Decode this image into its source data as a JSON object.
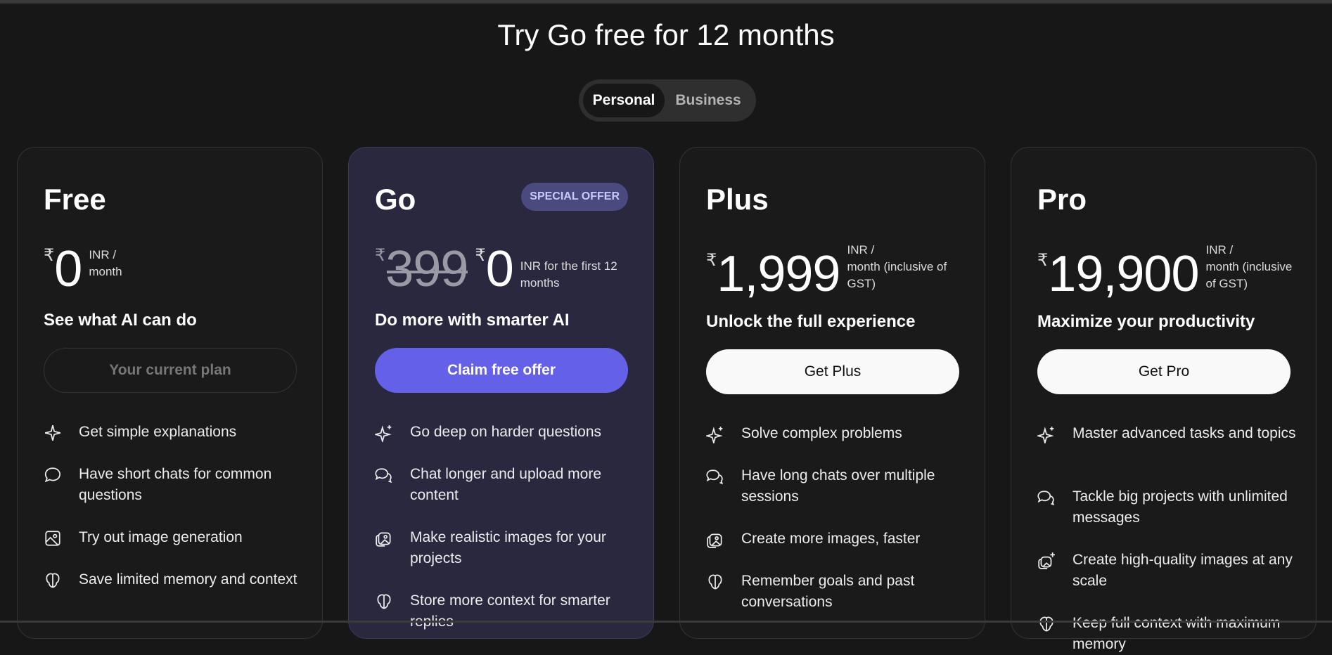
{
  "page_title": "Try Go free for 12 months",
  "toggle": {
    "personal": "Personal",
    "business": "Business"
  },
  "plans": [
    {
      "name": "Free",
      "currency": "₹",
      "price": "0",
      "unit_line1": "INR /",
      "unit_line2": "month",
      "tagline": "See what AI can do",
      "cta": "Your current plan",
      "features": [
        {
          "icon": "sparkle-icon",
          "text": "Get simple explanations"
        },
        {
          "icon": "chat-bubble-icon",
          "text": "Have short chats for common questions"
        },
        {
          "icon": "image-icon",
          "text": "Try out image generation"
        },
        {
          "icon": "brain-icon",
          "text": "Save limited memory and context"
        }
      ]
    },
    {
      "name": "Go",
      "badge": "SPECIAL OFFER",
      "currency": "₹",
      "old_price": "399",
      "price": "0",
      "unit_line1": "INR for the first 12",
      "unit_line2": "months",
      "tagline": "Do more with smarter AI",
      "cta": "Claim free offer",
      "features": [
        {
          "icon": "sparkles-icon",
          "text": "Go deep on harder questions"
        },
        {
          "icon": "chat-bubbles-icon",
          "text": "Chat longer and upload more content"
        },
        {
          "icon": "images-icon",
          "text": "Make realistic images for your projects"
        },
        {
          "icon": "brain-icon",
          "text": "Store more context for smarter replies"
        }
      ]
    },
    {
      "name": "Plus",
      "currency": "₹",
      "price": "1,999",
      "unit_line1": "INR /",
      "unit_line2": "month (inclusive of",
      "unit_line3": "GST)",
      "tagline": "Unlock the full experience",
      "cta": "Get Plus",
      "features": [
        {
          "icon": "sparkles-icon",
          "text": "Solve complex problems"
        },
        {
          "icon": "chat-bubbles-icon",
          "text": "Have long chats over multiple sessions"
        },
        {
          "icon": "images-icon",
          "text": "Create more images, faster"
        },
        {
          "icon": "brain-icon",
          "text": "Remember goals and past conversations"
        }
      ]
    },
    {
      "name": "Pro",
      "currency": "₹",
      "price": "19,900",
      "unit_line1": "INR /",
      "unit_line2": "month (inclusive",
      "unit_line3": "of GST)",
      "tagline": "Maximize your productivity",
      "cta": "Get Pro",
      "features": [
        {
          "icon": "sparkles-icon",
          "text": "Master advanced tasks and topics"
        },
        {
          "icon": "chat-bubbles-icon",
          "text": "Tackle big projects with unlimited messages"
        },
        {
          "icon": "images-sparkle-icon",
          "text": "Create high-quality images at any scale"
        },
        {
          "icon": "brain-icon",
          "text": "Keep full context with maximum memory"
        }
      ]
    }
  ]
}
